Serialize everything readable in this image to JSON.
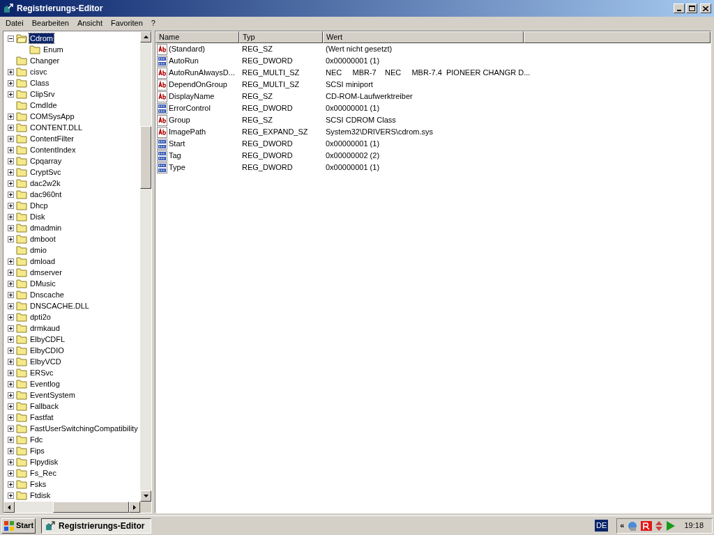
{
  "window": {
    "title": "Registrierungs-Editor"
  },
  "menu": [
    "Datei",
    "Bearbeiten",
    "Ansicht",
    "Favoriten",
    "?"
  ],
  "tree": [
    {
      "label": "Cdrom",
      "kind": "expanded",
      "selected": true,
      "children": [
        {
          "label": "Enum",
          "kind": "leaf",
          "selected": false
        }
      ]
    },
    {
      "label": "Changer",
      "kind": "leaf",
      "selected": false
    },
    {
      "label": "cisvc",
      "kind": "collapsed",
      "selected": false
    },
    {
      "label": "Class",
      "kind": "collapsed",
      "selected": false
    },
    {
      "label": "ClipSrv",
      "kind": "collapsed",
      "selected": false
    },
    {
      "label": "CmdIde",
      "kind": "leaf",
      "selected": false
    },
    {
      "label": "COMSysApp",
      "kind": "collapsed",
      "selected": false
    },
    {
      "label": "CONTENT.DLL",
      "kind": "collapsed",
      "selected": false
    },
    {
      "label": "ContentFilter",
      "kind": "collapsed",
      "selected": false
    },
    {
      "label": "ContentIndex",
      "kind": "collapsed",
      "selected": false
    },
    {
      "label": "Cpqarray",
      "kind": "collapsed",
      "selected": false
    },
    {
      "label": "CryptSvc",
      "kind": "collapsed",
      "selected": false
    },
    {
      "label": "dac2w2k",
      "kind": "collapsed",
      "selected": false
    },
    {
      "label": "dac960nt",
      "kind": "collapsed",
      "selected": false
    },
    {
      "label": "Dhcp",
      "kind": "collapsed",
      "selected": false
    },
    {
      "label": "Disk",
      "kind": "collapsed",
      "selected": false
    },
    {
      "label": "dmadmin",
      "kind": "collapsed",
      "selected": false
    },
    {
      "label": "dmboot",
      "kind": "collapsed",
      "selected": false
    },
    {
      "label": "dmio",
      "kind": "leaf",
      "selected": false
    },
    {
      "label": "dmload",
      "kind": "collapsed",
      "selected": false
    },
    {
      "label": "dmserver",
      "kind": "collapsed",
      "selected": false
    },
    {
      "label": "DMusic",
      "kind": "collapsed",
      "selected": false
    },
    {
      "label": "Dnscache",
      "kind": "collapsed",
      "selected": false
    },
    {
      "label": "DNSCACHE.DLL",
      "kind": "collapsed",
      "selected": false
    },
    {
      "label": "dpti2o",
      "kind": "collapsed",
      "selected": false
    },
    {
      "label": "drmkaud",
      "kind": "collapsed",
      "selected": false
    },
    {
      "label": "ElbyCDFL",
      "kind": "collapsed",
      "selected": false
    },
    {
      "label": "ElbyCDIO",
      "kind": "collapsed",
      "selected": false
    },
    {
      "label": "ElbyVCD",
      "kind": "collapsed",
      "selected": false
    },
    {
      "label": "ERSvc",
      "kind": "collapsed",
      "selected": false
    },
    {
      "label": "Eventlog",
      "kind": "collapsed",
      "selected": false
    },
    {
      "label": "EventSystem",
      "kind": "collapsed",
      "selected": false
    },
    {
      "label": "Fallback",
      "kind": "collapsed",
      "selected": false
    },
    {
      "label": "Fastfat",
      "kind": "collapsed",
      "selected": false
    },
    {
      "label": "FastUserSwitchingCompatibility",
      "kind": "collapsed",
      "selected": false
    },
    {
      "label": "Fdc",
      "kind": "collapsed",
      "selected": false
    },
    {
      "label": "Fips",
      "kind": "collapsed",
      "selected": false
    },
    {
      "label": "Flpydisk",
      "kind": "collapsed",
      "selected": false
    },
    {
      "label": "Fs_Rec",
      "kind": "collapsed",
      "selected": false
    },
    {
      "label": "Fsks",
      "kind": "collapsed",
      "selected": false
    },
    {
      "label": "Ftdisk",
      "kind": "collapsed",
      "selected": false
    }
  ],
  "table": {
    "columns": [
      "Name",
      "Typ",
      "Wert"
    ],
    "rows": [
      {
        "kind": "string",
        "name": "(Standard)",
        "type": "REG_SZ",
        "value": "(Wert nicht gesetzt)"
      },
      {
        "kind": "binary",
        "name": "AutoRun",
        "type": "REG_DWORD",
        "value": "0x00000001 (1)"
      },
      {
        "kind": "string",
        "name": "AutoRunAlwaysD...",
        "type": "REG_MULTI_SZ",
        "value": "NEC     MBR-7    NEC     MBR-7.4  PIONEER CHANGR D..."
      },
      {
        "kind": "string",
        "name": "DependOnGroup",
        "type": "REG_MULTI_SZ",
        "value": "SCSI miniport"
      },
      {
        "kind": "string",
        "name": "DisplayName",
        "type": "REG_SZ",
        "value": "CD-ROM-Laufwerktreiber"
      },
      {
        "kind": "binary",
        "name": "ErrorControl",
        "type": "REG_DWORD",
        "value": "0x00000001 (1)"
      },
      {
        "kind": "string",
        "name": "Group",
        "type": "REG_SZ",
        "value": "SCSI CDROM Class"
      },
      {
        "kind": "string",
        "name": "ImagePath",
        "type": "REG_EXPAND_SZ",
        "value": "System32\\DRIVERS\\cdrom.sys"
      },
      {
        "kind": "binary",
        "name": "Start",
        "type": "REG_DWORD",
        "value": "0x00000001 (1)"
      },
      {
        "kind": "binary",
        "name": "Tag",
        "type": "REG_DWORD",
        "value": "0x00000002 (2)"
      },
      {
        "kind": "binary",
        "name": "Type",
        "type": "REG_DWORD",
        "value": "0x00000001 (1)"
      }
    ]
  },
  "taskbar": {
    "start": "Start",
    "tasks": [
      {
        "label": "Registrierungs-Editor",
        "selected": true
      }
    ],
    "language": "DE",
    "tray_expand": "«",
    "clock": "19:18"
  }
}
